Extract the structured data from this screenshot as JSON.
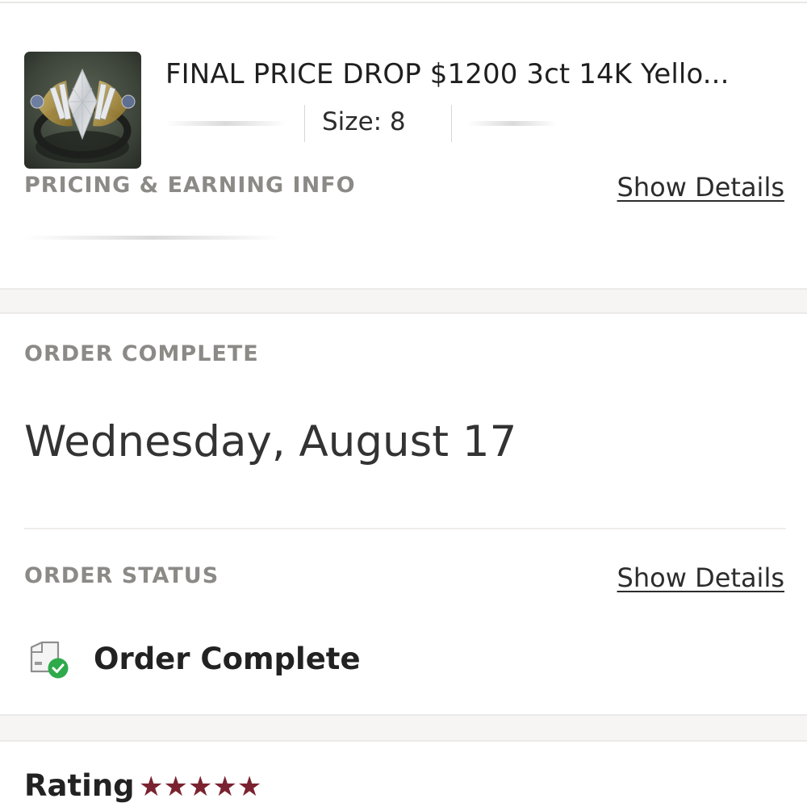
{
  "product": {
    "title": "FINAL PRICE DROP $1200 3ct 14K Yello...",
    "size": "Size: 8",
    "image_alt": "marquise diamond ring"
  },
  "pricing": {
    "label": "PRICING & EARNING INFO",
    "show_details": "Show Details"
  },
  "order": {
    "section_label": "ORDER COMPLETE",
    "date": "Wednesday, August 17",
    "status_label": "ORDER STATUS",
    "show_details": "Show Details",
    "status_text": "Order Complete",
    "status_icon": "package-check-icon"
  },
  "rating": {
    "label": "Rating",
    "stars_display": "★★★★★",
    "value": 5,
    "max": 5,
    "star_color": "#7a2230"
  },
  "colors": {
    "section_label": "#8c8a87",
    "check_green": "#2eaa4b",
    "divider": "#eceae8"
  }
}
